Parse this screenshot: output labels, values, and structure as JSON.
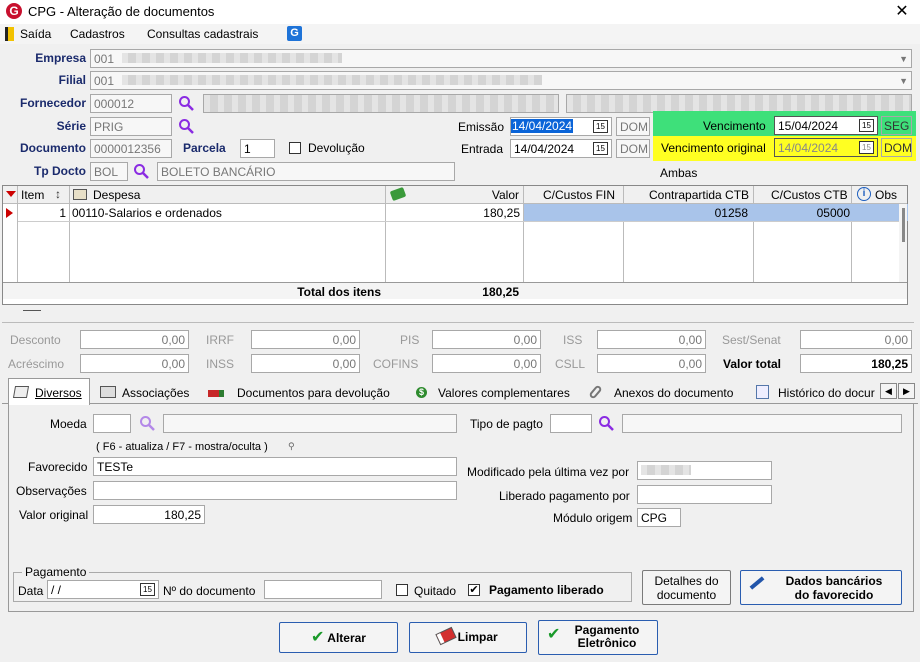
{
  "window": {
    "title": "CPG - Alteração de documentos"
  },
  "menu": {
    "items": [
      "Saída",
      "Cadastros",
      "Consultas cadastrais"
    ]
  },
  "header": {
    "empresa_label": "Empresa",
    "empresa_value": "001",
    "filial_label": "Filial",
    "filial_value": "001",
    "fornecedor_label": "Fornecedor",
    "fornecedor_value": "000012",
    "serie_label": "Série",
    "serie_value": "PRIG",
    "documento_label": "Documento",
    "documento_value": "0000012356",
    "parcela_label": "Parcela",
    "parcela_value": "1",
    "devolucao_label": "Devolução",
    "tpdocto_label": "Tp Docto",
    "tpdocto_value": "BOL",
    "tpdocto_desc": "BOLETO BANCÁRIO",
    "emissao_label": "Emissão",
    "emissao_value": "14/04/2024",
    "emissao_day": "DOM",
    "entrada_label": "Entrada",
    "entrada_value": "14/04/2024",
    "entrada_day": "DOM",
    "vencimento_label": "Vencimento",
    "vencimento_value": "15/04/2024",
    "vencimento_day": "SEG",
    "venc_original_label": "Vencimento original",
    "venc_original_value": "14/04/2024",
    "venc_original_day": "DOM",
    "ambas": "Ambas"
  },
  "grid": {
    "headers": [
      "Item",
      "Despesa",
      "Valor",
      "C/Custos FIN",
      "Contrapartida CTB",
      "C/Custos CTB",
      "Obs"
    ],
    "rows": [
      {
        "item": "1",
        "despesa": "00110-Salarios e ordenados",
        "valor": "180,25",
        "cc_fin": "",
        "contrapartida": "01258",
        "cc_ctb": "05000"
      }
    ],
    "total_label": "Total dos itens",
    "total_value": "180,25"
  },
  "totals": {
    "desconto_label": "Desconto",
    "desconto": "0,00",
    "irrf_label": "IRRF",
    "irrf": "0,00",
    "pis_label": "PIS",
    "pis": "0,00",
    "iss_label": "ISS",
    "iss": "0,00",
    "sest_label": "Sest/Senat",
    "sest": "0,00",
    "acrescimo_label": "Acréscimo",
    "acrescimo": "0,00",
    "inss_label": "INSS",
    "inss": "0,00",
    "cofins_label": "COFINS",
    "cofins": "0,00",
    "csll_label": "CSLL",
    "csll": "0,00",
    "valortotal_label": "Valor total",
    "valortotal": "180,25"
  },
  "tabs": [
    "Diversos",
    "Associações",
    "Documentos para devolução",
    "Valores complementares",
    "Anexos do documento",
    "Histórico do docur"
  ],
  "diversos": {
    "moeda_label": "Moeda",
    "tipopagto_label": "Tipo de pagto",
    "hint": "( F6 - atualiza / F7 - mostra/oculta )",
    "favorecido_label": "Favorecido",
    "favorecido_value": "TESTe",
    "observacoes_label": "Observações",
    "valororiginal_label": "Valor original",
    "valororiginal_value": "180,25",
    "modificado_label": "Modificado pela última vez por",
    "liberado_label": "Liberado pagamento por",
    "modulo_label": "Módulo origem",
    "modulo_value": "CPG",
    "pagamento_label": "Pagamento",
    "data_label": "Data",
    "data_value": " / /",
    "ndoc_label": "Nº do documento",
    "quitado_label": "Quitado",
    "liberado_chk_label": "Pagamento liberado",
    "detalhes_line1": "Detalhes do",
    "detalhes_line2": "documento",
    "dados_line1": "Dados bancários",
    "dados_line2": "do favorecido"
  },
  "buttons": {
    "alterar": "Alterar",
    "limpar": "Limpar",
    "pag_line1": "Pagamento",
    "pag_line2": "Eletrônico"
  },
  "colors": {
    "vencimento": "#3ee07a",
    "original": "#ffff22",
    "selection": "#a9c4ea"
  }
}
